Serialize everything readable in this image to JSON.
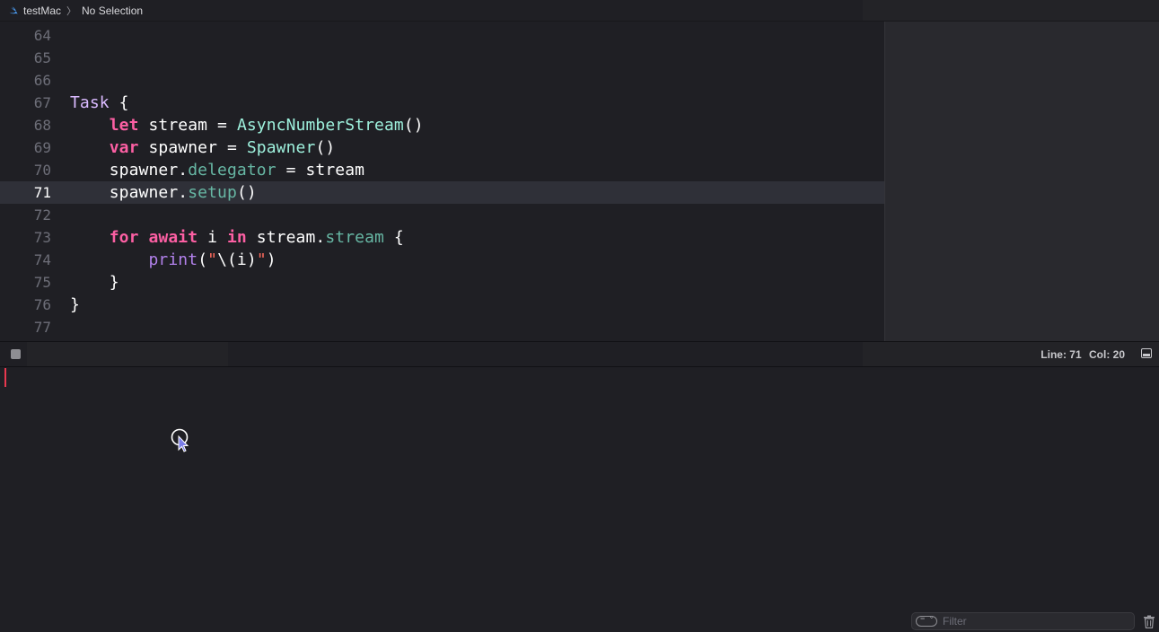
{
  "breadcrumb": {
    "project": "testMac",
    "separator": "〉",
    "selection": "No Selection"
  },
  "editor": {
    "current_line": 71,
    "lines": [
      {
        "num": "64",
        "tokens": []
      },
      {
        "num": "65",
        "tokens": []
      },
      {
        "num": "66",
        "tokens": []
      },
      {
        "num": "67",
        "tokens": [
          {
            "t": "Task",
            "c": "type"
          },
          {
            "t": " {",
            "c": "plain"
          }
        ]
      },
      {
        "num": "68",
        "tokens": [
          {
            "t": "    ",
            "c": "plain"
          },
          {
            "t": "let",
            "c": "kw"
          },
          {
            "t": " stream = ",
            "c": "plain"
          },
          {
            "t": "AsyncNumberStream",
            "c": "cls"
          },
          {
            "t": "()",
            "c": "plain"
          }
        ]
      },
      {
        "num": "69",
        "tokens": [
          {
            "t": "    ",
            "c": "plain"
          },
          {
            "t": "var",
            "c": "kw"
          },
          {
            "t": " spawner = ",
            "c": "plain"
          },
          {
            "t": "Spawner",
            "c": "cls"
          },
          {
            "t": "()",
            "c": "plain"
          }
        ]
      },
      {
        "num": "70",
        "tokens": [
          {
            "t": "    spawner.",
            "c": "plain"
          },
          {
            "t": "delegator",
            "c": "prop"
          },
          {
            "t": " = stream",
            "c": "plain"
          }
        ]
      },
      {
        "num": "71",
        "tokens": [
          {
            "t": "    spawner.",
            "c": "plain"
          },
          {
            "t": "setup",
            "c": "prop"
          },
          {
            "t": "()",
            "c": "plain"
          }
        ]
      },
      {
        "num": "72",
        "tokens": []
      },
      {
        "num": "73",
        "tokens": [
          {
            "t": "    ",
            "c": "plain"
          },
          {
            "t": "for",
            "c": "kw"
          },
          {
            "t": " ",
            "c": "plain"
          },
          {
            "t": "await",
            "c": "kw"
          },
          {
            "t": " i ",
            "c": "plain"
          },
          {
            "t": "in",
            "c": "kw"
          },
          {
            "t": " stream.",
            "c": "plain"
          },
          {
            "t": "stream",
            "c": "prop"
          },
          {
            "t": " {",
            "c": "plain"
          }
        ]
      },
      {
        "num": "74",
        "tokens": [
          {
            "t": "        ",
            "c": "plain"
          },
          {
            "t": "print",
            "c": "fn"
          },
          {
            "t": "(",
            "c": "plain"
          },
          {
            "t": "\"",
            "c": "str"
          },
          {
            "t": "\\(i)",
            "c": "plain"
          },
          {
            "t": "\"",
            "c": "str"
          },
          {
            "t": ")",
            "c": "plain"
          }
        ]
      },
      {
        "num": "75",
        "tokens": [
          {
            "t": "    }",
            "c": "plain"
          }
        ]
      },
      {
        "num": "76",
        "tokens": [
          {
            "t": "}",
            "c": "plain"
          }
        ]
      },
      {
        "num": "77",
        "tokens": []
      }
    ]
  },
  "debugbar": {
    "line_label": "Line: 71",
    "col_label": "Col: 20"
  },
  "console": {
    "filter_placeholder": "Filter",
    "filter_value": ""
  }
}
